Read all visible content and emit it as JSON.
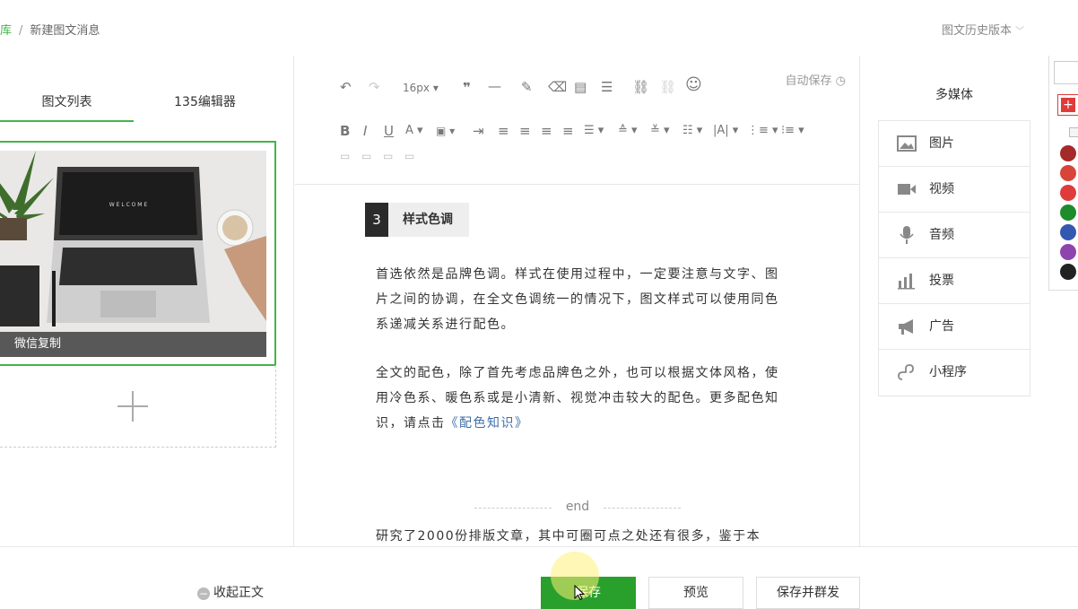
{
  "header": {
    "breadcrumb_parent": "素材库",
    "breadcrumb_sep": "/",
    "breadcrumb_current": "新建图文消息",
    "history_label": "图文历史版本"
  },
  "left": {
    "tab_list": "图文列表",
    "tab_135": "135编辑器",
    "article_caption": "微信复制"
  },
  "toolbar": {
    "font_size": "16px",
    "autosave": "自动保存"
  },
  "content": {
    "section_number": "3",
    "section_title": "样式色调",
    "para1": "首选依然是品牌色调。样式在使用过程中，一定要注意与文字、图片之间的协调，在全文色调统一的情况下，图文样式可以使用同色系递减关系进行配色。",
    "para2_text": "全文的配色，除了首先考虑品牌色之外，也可以根据文体风格，使用冷色系、暖色系或是小清新、视觉冲击较大的配色。更多配色知识，请点击",
    "para2_link": "《配色知识》",
    "end_text": "end",
    "para3": "研究了2000份排版文章，其中可圈可点之处还有很多，鉴于本"
  },
  "media": {
    "title": "多媒体",
    "items": [
      {
        "label": "图片",
        "icon": "image-icon"
      },
      {
        "label": "视频",
        "icon": "video-icon"
      },
      {
        "label": "音频",
        "icon": "microphone-icon"
      },
      {
        "label": "投票",
        "icon": "bar-chart-icon"
      },
      {
        "label": "广告",
        "icon": "megaphone-icon"
      },
      {
        "label": "小程序",
        "icon": "mini-program-icon"
      }
    ]
  },
  "colors": {
    "accent": "#44b549",
    "swatches": [
      "#a52a2a",
      "#d9443a",
      "#e03b3b",
      "#1e8c2a",
      "#3457b0",
      "#8e44ad",
      "#222222"
    ]
  },
  "footer": {
    "collapse_label": "收起正文",
    "save_label": "保存",
    "preview_label": "预览",
    "save_send_label": "保存并群发"
  }
}
